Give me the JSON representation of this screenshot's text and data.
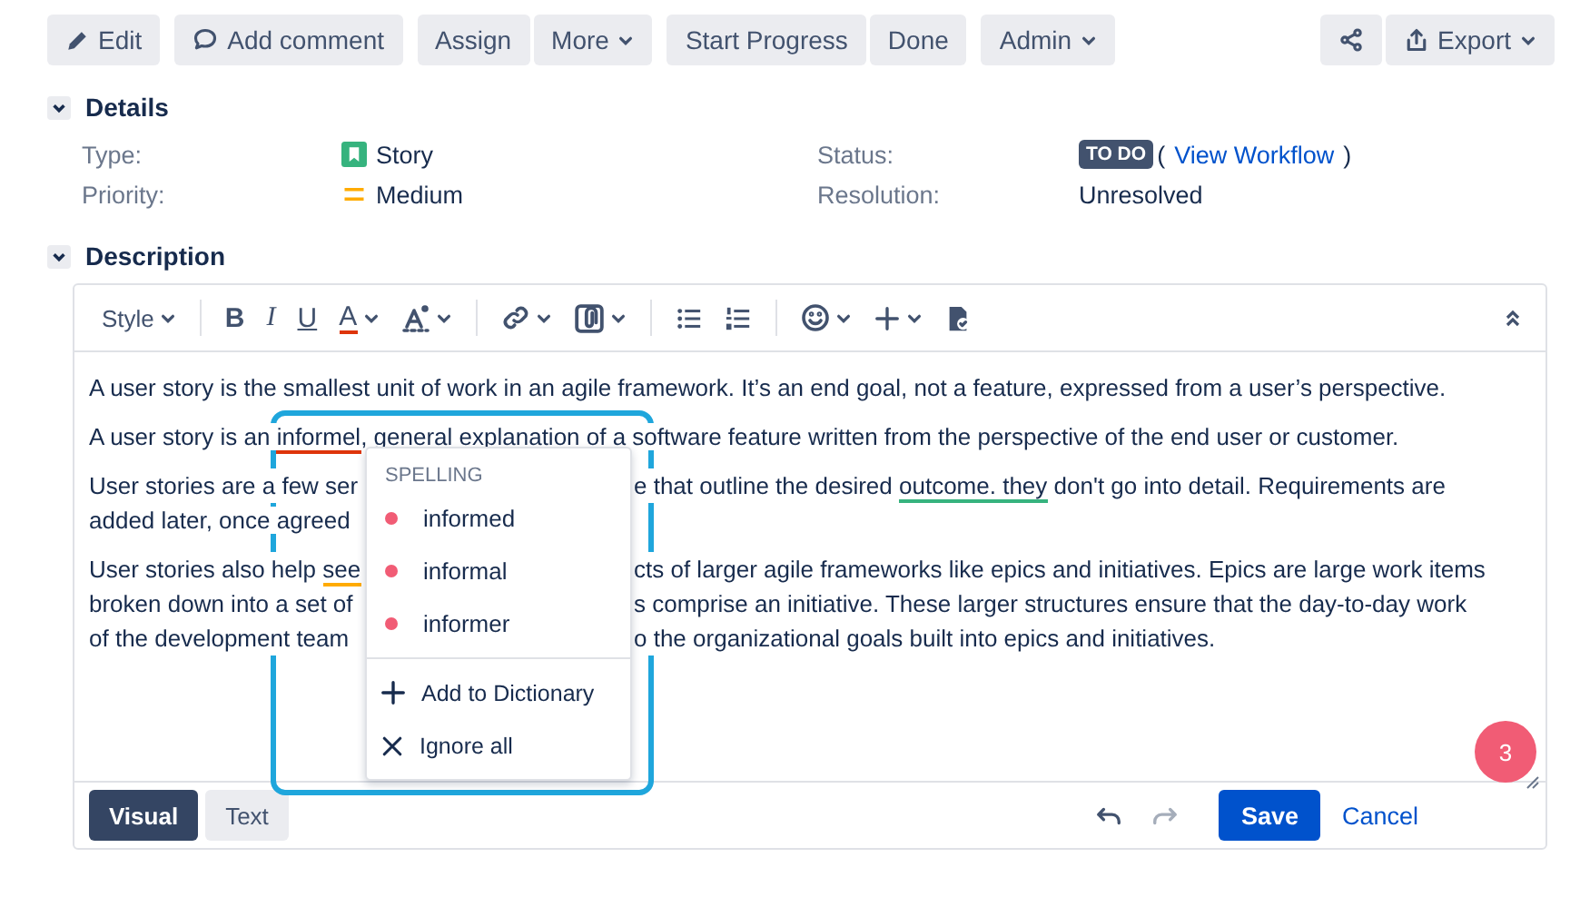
{
  "actions": {
    "left": [
      [
        {
          "label": "Edit",
          "caret": false
        }
      ],
      [
        {
          "label": "Add comment",
          "caret": false
        }
      ],
      [
        {
          "label": "Assign",
          "caret": false
        },
        {
          "label": "More",
          "caret": true
        }
      ],
      [
        {
          "label": "Start Progress",
          "caret": false
        },
        {
          "label": "Done",
          "caret": false
        }
      ],
      [
        {
          "label": "Admin",
          "caret": true
        }
      ]
    ],
    "right": [
      [
        {
          "caret": false
        },
        {
          "label": "Export",
          "caret": true
        }
      ]
    ]
  },
  "details": {
    "title": "Details",
    "expanded": true,
    "fields": [
      {
        "label": "Type:",
        "value": "Story"
      },
      {
        "label": "Status:",
        "badge": "TO DO",
        "open": "(",
        "link": "View Workflow",
        "close": ")"
      },
      {
        "label": "Priority:",
        "value": "Medium"
      },
      {
        "label": "Resolution:",
        "value": "Unresolved"
      }
    ]
  },
  "description": {
    "title": "Description",
    "expanded": true,
    "tool_groups": [
      [
        {
          "kind": "dropdown",
          "label": "Style",
          "caret": true
        }
      ],
      [
        {
          "kind": "glyph",
          "text": "B",
          "caret": false
        },
        {
          "kind": "glyph",
          "text": "I",
          "caret": false
        },
        {
          "kind": "glyph",
          "text": "U",
          "caret": false
        },
        {
          "kind": "glyph",
          "text": "A",
          "caret": true
        },
        {
          "kind": "icon",
          "caret": true
        }
      ],
      [
        {
          "kind": "icon",
          "caret": true
        },
        {
          "kind": "icon",
          "caret": true
        }
      ],
      [
        {
          "kind": "icon",
          "caret": false
        },
        {
          "kind": "icon",
          "caret": false
        }
      ],
      [
        {
          "kind": "icon",
          "caret": true
        },
        {
          "kind": "icon",
          "caret": true
        },
        {
          "kind": "icon",
          "caret": false
        }
      ]
    ],
    "paragraphs": [
      [
        {
          "before": [
            {
              "text": "A user story is the smallest unit of work in an agile framework. It’s an end goal, not a feature, expressed from a user’s perspective."
            }
          ]
        }
      ],
      [
        {
          "before": [
            {
              "text": "A user story is an "
            },
            {
              "text": "informel",
              "color": "#de350b"
            },
            {
              "text": ", general explanation of a software feature written from the perspective of the end user or customer."
            }
          ]
        }
      ],
      [
        {
          "before": [
            {
              "text": "User stories are a few ser"
            }
          ],
          "after": [
            {
              "text": "e that outline the desired "
            },
            {
              "text": "outcome. they",
              "color": "#36b37e"
            },
            {
              "text": " don't go into detail. Requirements are"
            }
          ]
        },
        {
          "before": [
            {
              "text": "added later, once agreed"
            }
          ]
        }
      ],
      [
        {
          "before": [
            {
              "text": "User stories also help "
            },
            {
              "text": "see",
              "color": "#ffab00"
            }
          ],
          "after": [
            {
              "text": "cts of larger agile frameworks like epics and initiatives. Epics are large work items"
            }
          ]
        },
        {
          "before": [
            {
              "text": "broken down into a set of"
            }
          ],
          "after": [
            {
              "text": "s comprise an initiative. These larger structures ensure that the day-to-day work"
            }
          ]
        },
        {
          "before": [
            {
              "text": "of the development team"
            }
          ],
          "after": [
            {
              "text": "o the organizational goals built into epics and initiatives."
            }
          ]
        }
      ]
    ],
    "spelling_menu": {
      "heading": "SPELLING",
      "suggestions": [
        "informed",
        "informal",
        "informer"
      ],
      "actions": [
        {
          "label": "Add to Dictionary"
        },
        {
          "label": "Ignore all"
        }
      ]
    },
    "badge": "3",
    "modes": [
      {
        "label": "Visual",
        "selected": true
      },
      {
        "label": "Text",
        "selected": false
      }
    ],
    "history": [
      {
        "disabled": false
      },
      {
        "disabled": true
      }
    ],
    "save": "Save",
    "cancel": "Cancel"
  }
}
